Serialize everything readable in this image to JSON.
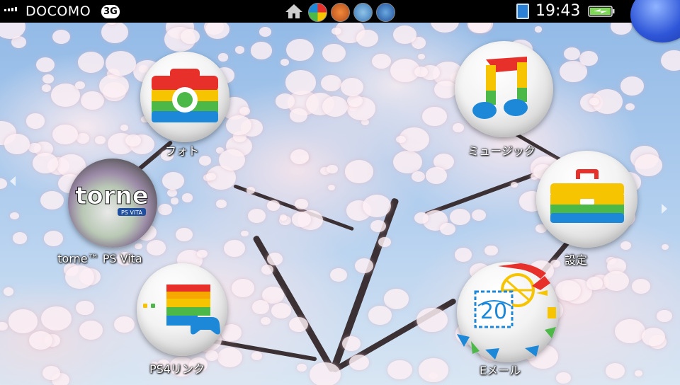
{
  "status_bar": {
    "carrier": "DOCOMO",
    "network": "3G",
    "time": "19:43",
    "icons": [
      "home-icon",
      "notification-icon",
      "battery-charging-icon"
    ]
  },
  "apps": [
    {
      "id": "photo",
      "label": "フォト",
      "icon": "camera-icon"
    },
    {
      "id": "music",
      "label": "ミュージック",
      "icon": "music-note-icon"
    },
    {
      "id": "torne",
      "label": "torne™ PS Vita",
      "icon": "torne-icon",
      "logo_text": "torne",
      "logo_sub": "PS VITA"
    },
    {
      "id": "settings",
      "label": "設定",
      "icon": "toolbox-icon"
    },
    {
      "id": "ps4link",
      "label": "PS4リンク",
      "icon": "ps4-link-icon"
    },
    {
      "id": "email",
      "label": "Eメール",
      "icon": "envelope-stamp-icon",
      "stamp_number": "20"
    }
  ],
  "colors": {
    "red": "#e8302a",
    "yellow": "#f6c400",
    "green": "#4cb848",
    "blue": "#1e88d8",
    "status_bar": "#000000"
  }
}
